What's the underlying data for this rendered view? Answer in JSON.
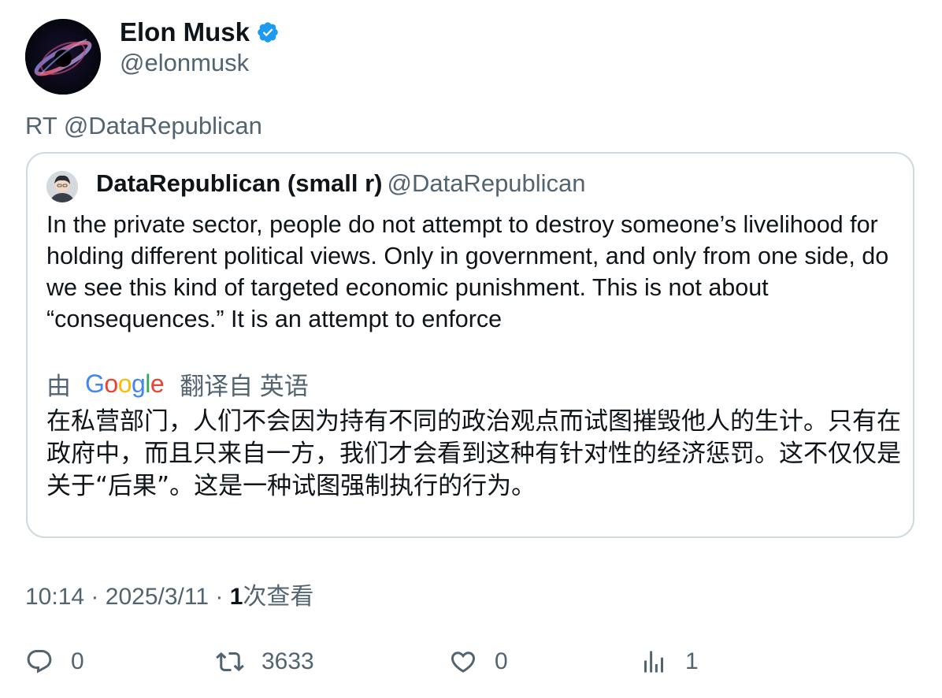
{
  "author": {
    "display_name": "Elon Musk",
    "handle": "@elonmusk",
    "verified_icon": "verified-badge-icon",
    "verified_color": "#1d9bf0"
  },
  "retweet_line": "RT @DataRepublican",
  "quoted": {
    "display_name": "DataRepublican (small r)",
    "handle": "@DataRepublican",
    "text": "In the private sector, people do not attempt to destroy someone’s livelihood for holding different political views. Only in government, and only from one side, do we see this kind of targeted economic punishment. This is not about “consequences.” It is an attempt to enforce",
    "translate": {
      "prefix": "由",
      "provider": "Google",
      "suffix": "翻译自 英语"
    },
    "translated_text": "在私营部门，人们不会因为持有不同的政治观点而试图摧毁他人的生计。只有在政府中，而且只来自一方，我们才会看到这种有针对性的经济惩罚。这不仅仅是关于“后果”。这是一种试图强制执行的行为。"
  },
  "meta": {
    "time": "10:14",
    "separator": "·",
    "date": "2025/3/11",
    "views_count": "1",
    "views_label": "次查看"
  },
  "actions": {
    "reply_count": "0",
    "retweet_count": "3633",
    "like_count": "0",
    "views_count": "1"
  },
  "colors": {
    "text_primary": "#0f1419",
    "text_secondary": "#536471",
    "border": "#cfd9de"
  }
}
